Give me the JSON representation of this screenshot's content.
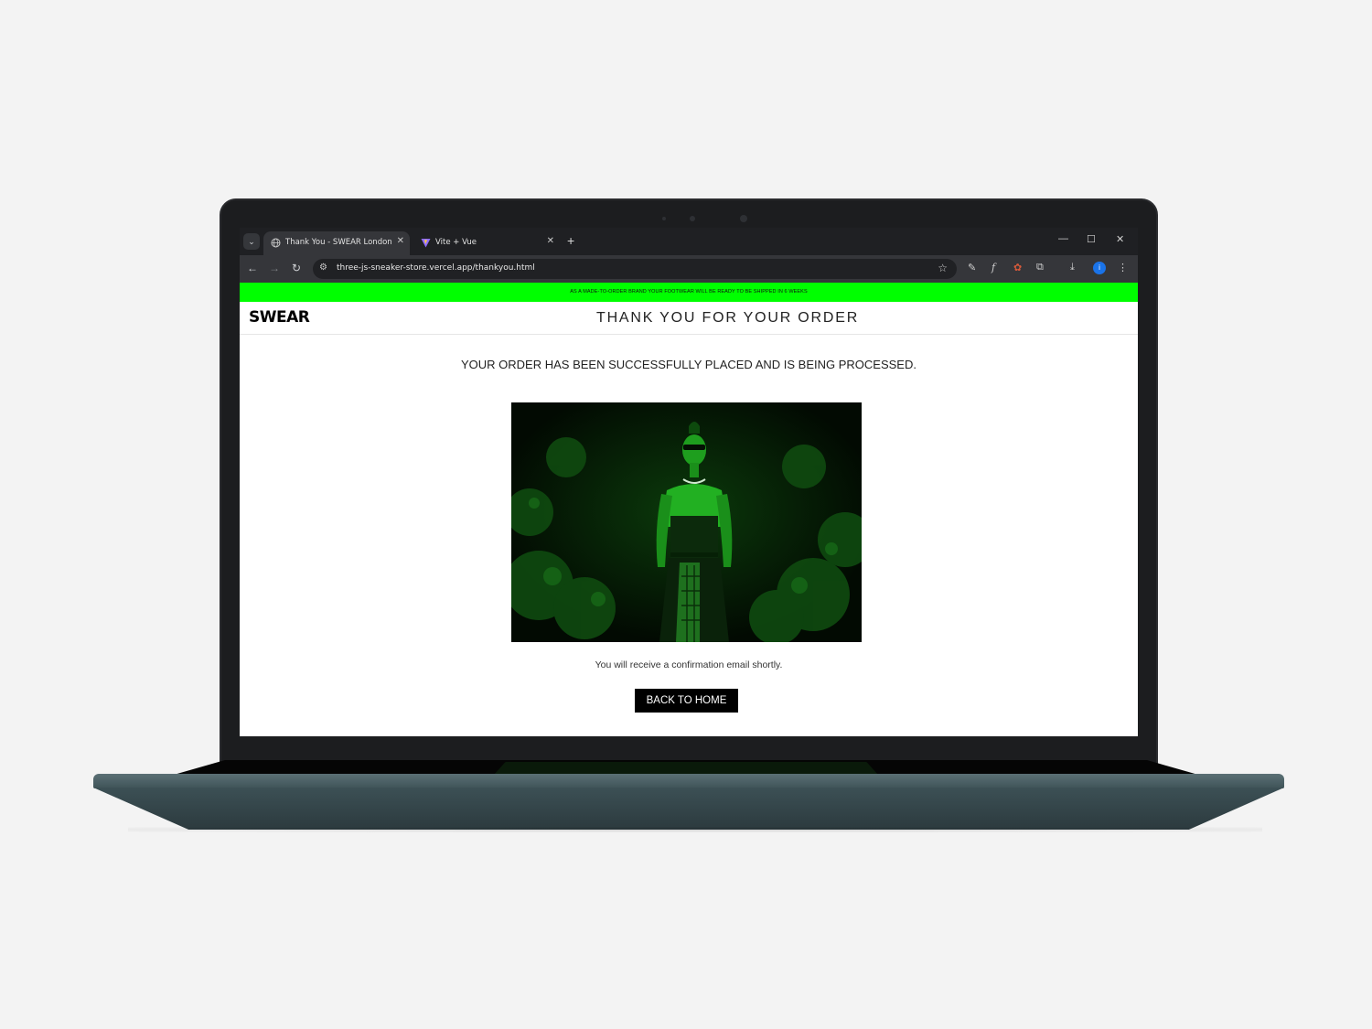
{
  "browser": {
    "tabs": [
      {
        "title": "Thank You - SWEAR London",
        "icon": "globe-icon",
        "active": true
      },
      {
        "title": "Vite + Vue",
        "icon": "vite-icon",
        "active": false
      }
    ],
    "url": "three-js-sneaker-store.vercel.app/thankyou.html",
    "profile_initial": "i"
  },
  "page": {
    "announcement": "AS A MADE-TO-ORDER BRAND YOUR FOOTWEAR WILL BE READY TO BE SHIPPED IN 6 WEEKS",
    "logo": "SWEAR",
    "title": "THANK YOU FOR YOUR ORDER",
    "message": "YOUR ORDER HAS BEEN SUCCESSFULLY PLACED AND IS BEING PROCESSED.",
    "confirmation": "You will receive a confirmation email shortly.",
    "back_button": "BACK TO HOME"
  },
  "colors": {
    "announcement_bg": "#00ff00",
    "hero_tint": "#00c800",
    "button_bg": "#000000"
  }
}
